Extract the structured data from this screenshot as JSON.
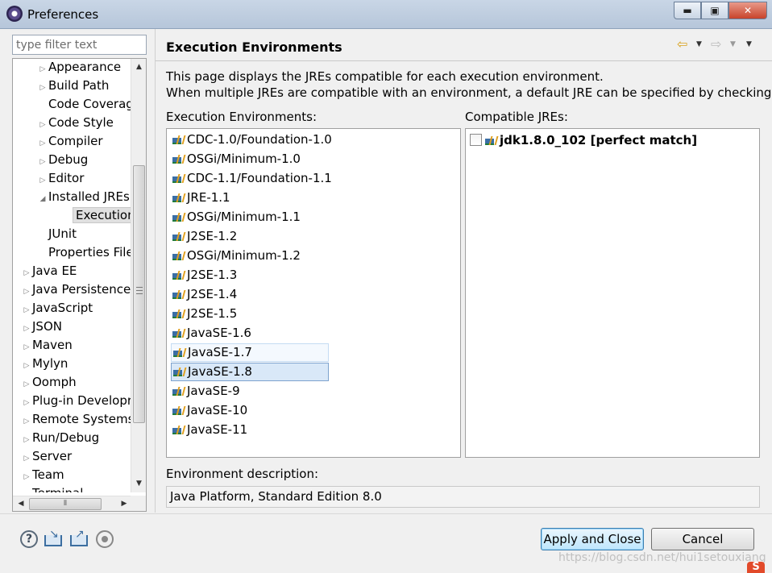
{
  "window": {
    "title": "Preferences",
    "minimize_label": "▬",
    "maximize_label": "▣",
    "close_label": "✕"
  },
  "sidebar": {
    "filter_placeholder": "type filter text",
    "items": [
      {
        "label": "Appearance",
        "level": 2,
        "arrow": "▷"
      },
      {
        "label": "Build Path",
        "level": 2,
        "arrow": "▷"
      },
      {
        "label": "Code Coverag",
        "level": 2,
        "arrow": ""
      },
      {
        "label": "Code Style",
        "level": 2,
        "arrow": "▷"
      },
      {
        "label": "Compiler",
        "level": 2,
        "arrow": "▷"
      },
      {
        "label": "Debug",
        "level": 2,
        "arrow": "▷"
      },
      {
        "label": "Editor",
        "level": 2,
        "arrow": "▷"
      },
      {
        "label": "Installed JREs",
        "level": 2,
        "arrow": "◢"
      },
      {
        "label": "Execution E",
        "level": 3,
        "arrow": "",
        "selected": true
      },
      {
        "label": "JUnit",
        "level": 2,
        "arrow": ""
      },
      {
        "label": "Properties File",
        "level": 2,
        "arrow": ""
      },
      {
        "label": "Java EE",
        "level": 1,
        "arrow": "▷"
      },
      {
        "label": "Java Persistence",
        "level": 1,
        "arrow": "▷"
      },
      {
        "label": "JavaScript",
        "level": 1,
        "arrow": "▷"
      },
      {
        "label": "JSON",
        "level": 1,
        "arrow": "▷"
      },
      {
        "label": "Maven",
        "level": 1,
        "arrow": "▷"
      },
      {
        "label": "Mylyn",
        "level": 1,
        "arrow": "▷"
      },
      {
        "label": "Oomph",
        "level": 1,
        "arrow": "▷"
      },
      {
        "label": "Plug-in Developr",
        "level": 1,
        "arrow": "▷"
      },
      {
        "label": "Remote Systems",
        "level": 1,
        "arrow": "▷"
      },
      {
        "label": "Run/Debug",
        "level": 1,
        "arrow": "▷"
      },
      {
        "label": "Server",
        "level": 1,
        "arrow": "▷"
      },
      {
        "label": "Team",
        "level": 1,
        "arrow": "▷"
      },
      {
        "label": "Terminal",
        "level": 1,
        "arrow": "▷"
      }
    ]
  },
  "page": {
    "title": "Execution Environments",
    "description_line1": "This page displays the JREs compatible for each execution environment.",
    "description_line2": "When multiple JREs are compatible with an environment, a default JRE can be specified by checking it.",
    "environments_label": "Execution Environments:",
    "compatible_label": "Compatible JREs:",
    "environments": [
      {
        "label": "CDC-1.0/Foundation-1.0",
        "state": ""
      },
      {
        "label": "OSGi/Minimum-1.0",
        "state": ""
      },
      {
        "label": "CDC-1.1/Foundation-1.1",
        "state": ""
      },
      {
        "label": "JRE-1.1",
        "state": ""
      },
      {
        "label": "OSGi/Minimum-1.1",
        "state": ""
      },
      {
        "label": "J2SE-1.2",
        "state": ""
      },
      {
        "label": "OSGi/Minimum-1.2",
        "state": ""
      },
      {
        "label": "J2SE-1.3",
        "state": ""
      },
      {
        "label": "J2SE-1.4",
        "state": ""
      },
      {
        "label": "J2SE-1.5",
        "state": ""
      },
      {
        "label": "JavaSE-1.6",
        "state": ""
      },
      {
        "label": "JavaSE-1.7",
        "state": "hover"
      },
      {
        "label": "JavaSE-1.8",
        "state": "selected"
      },
      {
        "label": "JavaSE-9",
        "state": ""
      },
      {
        "label": "JavaSE-10",
        "state": ""
      },
      {
        "label": "JavaSE-11",
        "state": ""
      }
    ],
    "compatible_jres": [
      {
        "label": "jdk1.8.0_102 [perfect match]",
        "checked": false
      }
    ],
    "env_description_label": "Environment description:",
    "env_description_value": "Java Platform, Standard Edition 8.0"
  },
  "buttons": {
    "apply_close": "Apply and Close",
    "cancel": "Cancel"
  },
  "icons": {
    "help": "?",
    "back": "⇦",
    "forward": "⇨",
    "dropdown": "▼"
  },
  "watermark": "https://blog.csdn.net/hui1setouxiang",
  "brand_mark": "S",
  "colors": {
    "selection": "#d9e8f8",
    "default_button": "#bee6fd"
  }
}
